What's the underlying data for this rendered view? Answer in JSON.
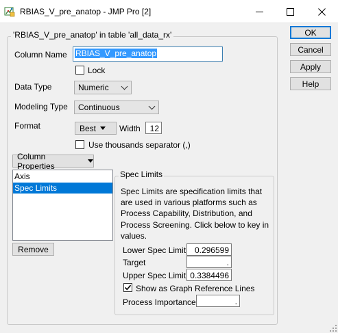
{
  "window": {
    "title": "RBIAS_V_pre_anatop - JMP Pro [2]",
    "minimize_glyph": "—",
    "maximize_glyph": "☐",
    "close_glyph": "✕"
  },
  "group": {
    "legend": "'RBIAS_V_pre_anatop' in table 'all_data_rx'"
  },
  "column_name": {
    "label": "Column Name",
    "value": "RBIAS_V_pre_anatop"
  },
  "lock": {
    "label": "Lock",
    "checked": false
  },
  "data_type": {
    "label": "Data Type",
    "selected": "Numeric"
  },
  "modeling_type": {
    "label": "Modeling Type",
    "selected": "Continuous"
  },
  "format": {
    "label": "Format",
    "button": "Best",
    "width_label": "Width",
    "width_value": "12"
  },
  "thousands": {
    "label": "Use thousands separator (,)",
    "checked": false
  },
  "column_properties": {
    "button": "Column Properties",
    "items": [
      "Axis",
      "Spec Limits"
    ],
    "selected": "Spec Limits",
    "remove": "Remove"
  },
  "spec_limits": {
    "legend": "Spec Limits",
    "description": "Spec Limits are specification limits that are used in various platforms such as Process Capability, Distribution, and Process Screening. Click below to key in values.",
    "lower_label": "Lower Spec Limit",
    "lower_value": "0.296599",
    "target_label": "Target",
    "target_value": ".",
    "upper_label": "Upper Spec Limit",
    "upper_value": "0.3384496",
    "reference_label": "Show as Graph Reference Lines",
    "reference_checked": true,
    "importance_label": "Process Importance",
    "importance_value": "."
  },
  "buttons": {
    "ok": "OK",
    "cancel": "Cancel",
    "apply": "Apply",
    "help": "Help"
  }
}
